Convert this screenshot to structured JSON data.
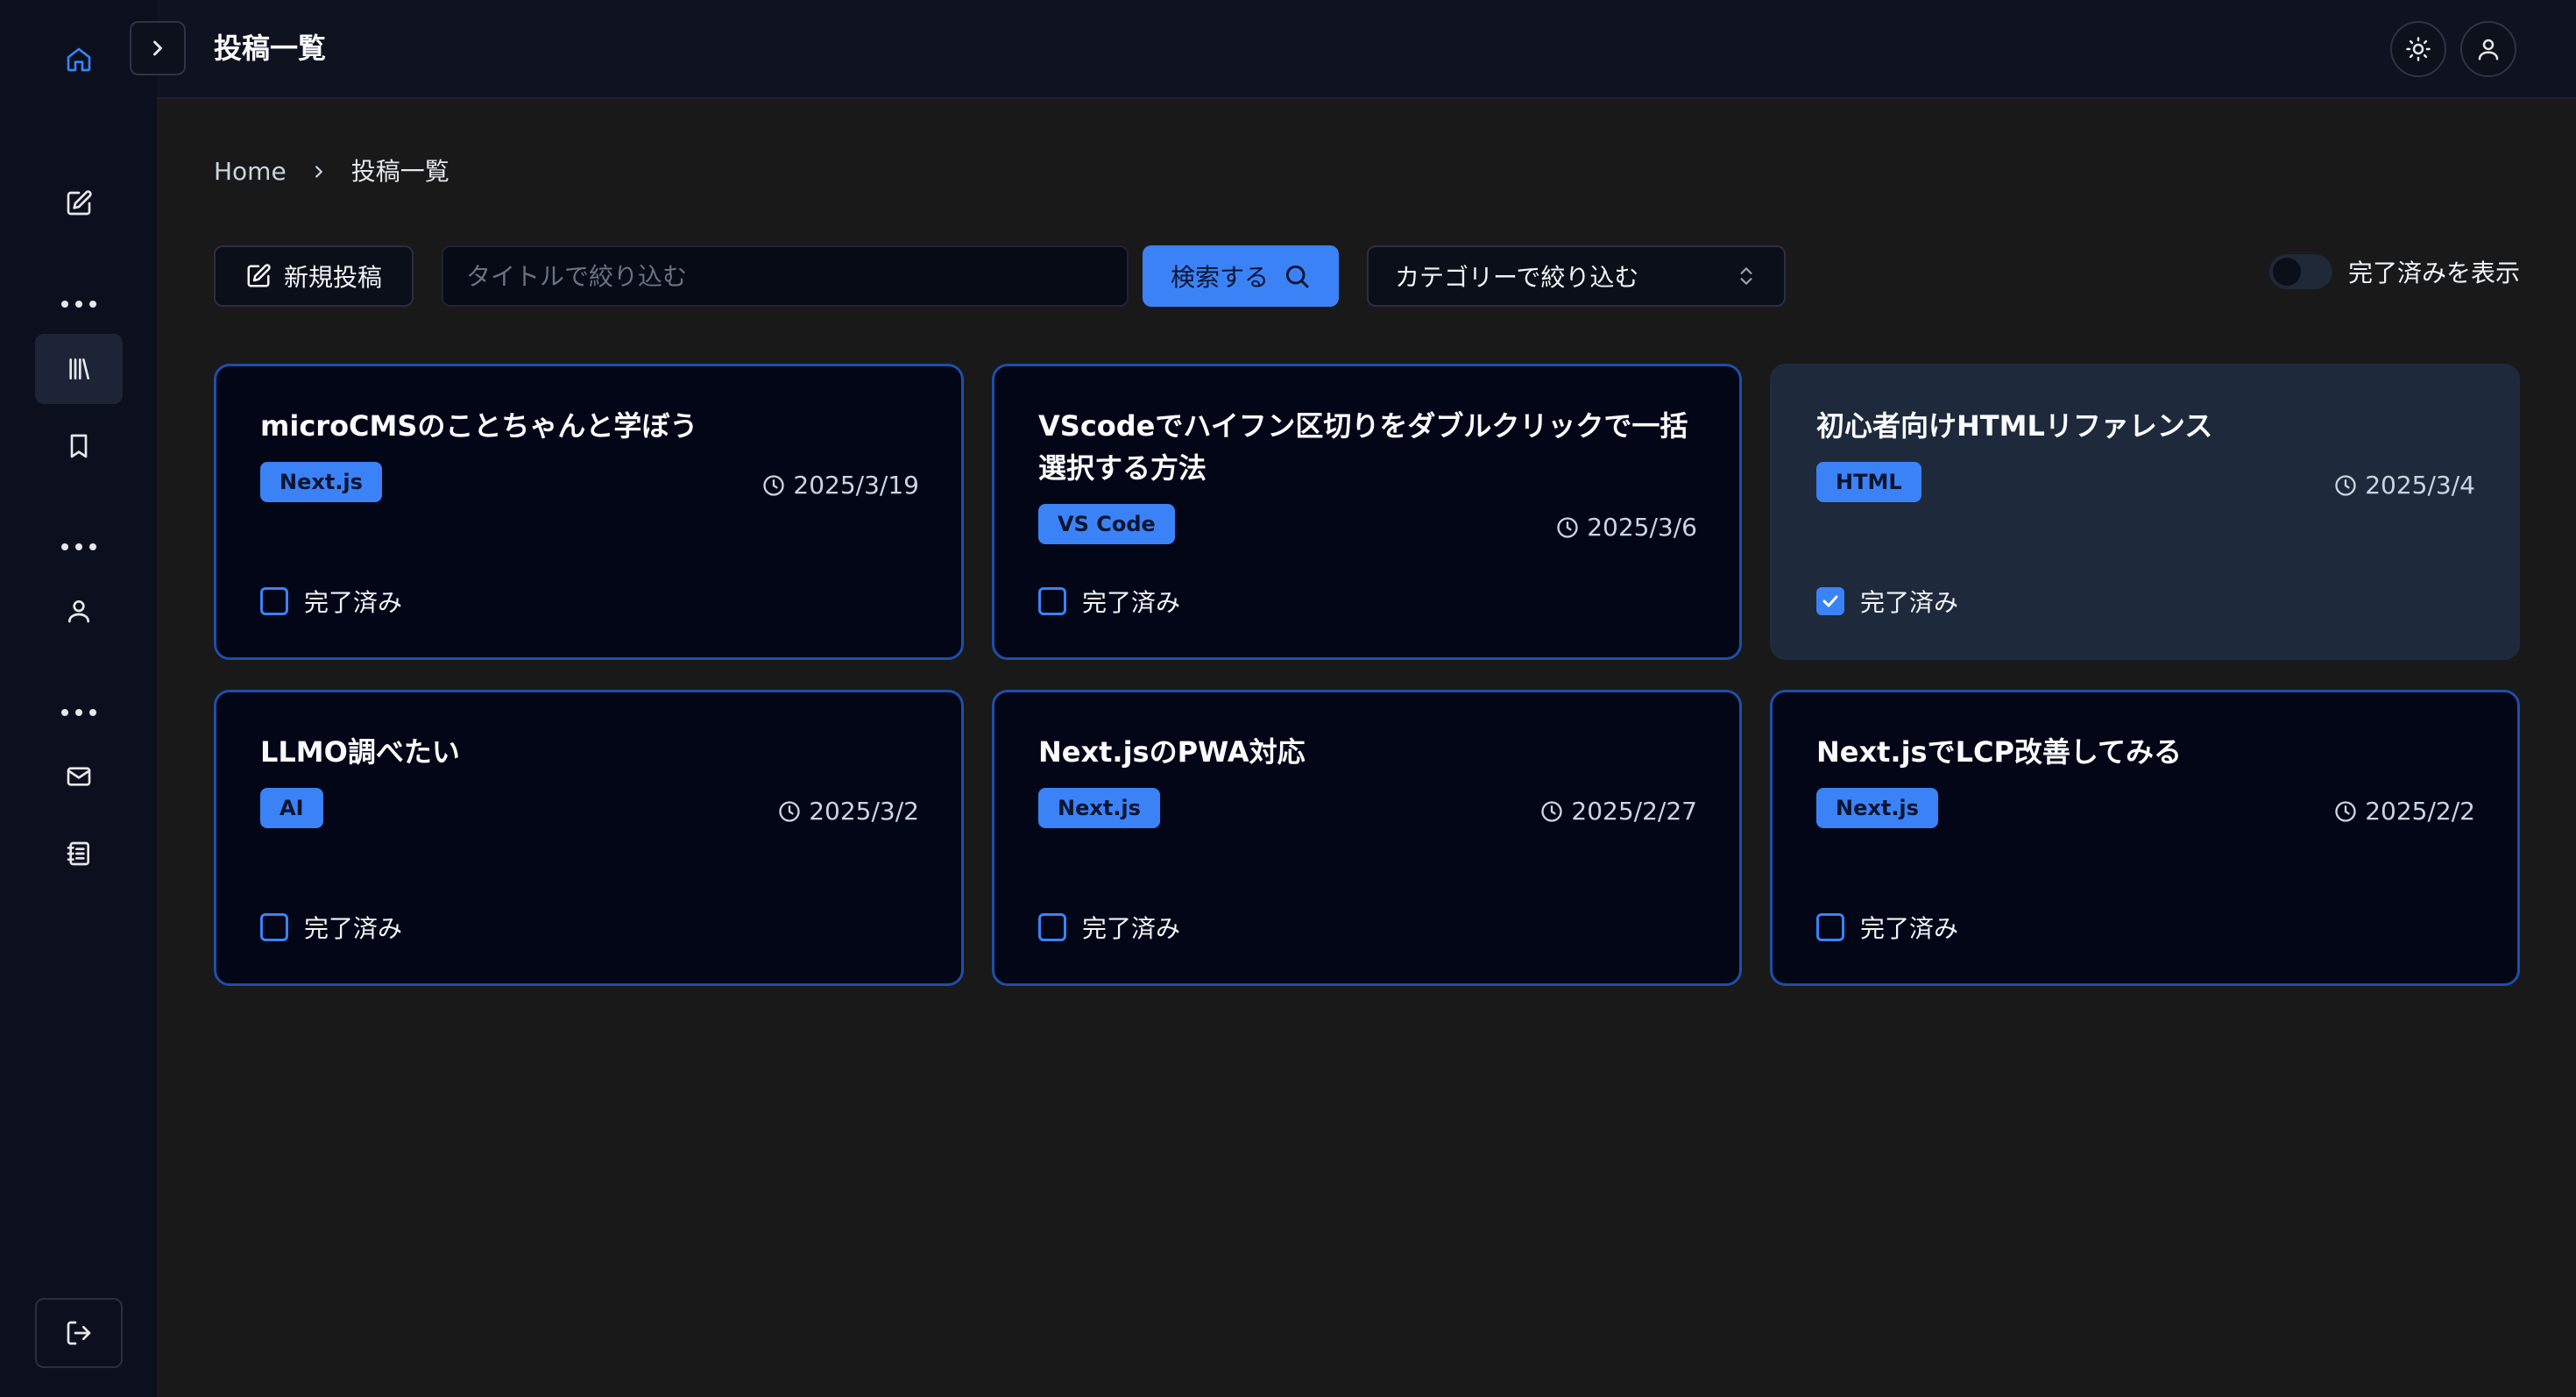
{
  "header": {
    "title": "投稿一覧"
  },
  "breadcrumb": {
    "home": "Home",
    "current": "投稿一覧"
  },
  "toolbar": {
    "new_post_label": "新規投稿",
    "search_placeholder": "タイトルで絞り込む",
    "search_button_label": "検索する",
    "category_select_value": "カテゴリーで絞り込む",
    "show_completed_label": "完了済みを表示",
    "show_completed_on": false
  },
  "checkbox_label": "完了済み",
  "posts": [
    {
      "title": "microCMSのことちゃんと学ぼう",
      "tag": "Next.js",
      "date": "2025/3/19",
      "completed": false
    },
    {
      "title": "VScodeでハイフン区切りをダブルクリックで一括選択する方法",
      "tag": "VS Code",
      "date": "2025/3/6",
      "completed": false
    },
    {
      "title": "初心者向けHTMLリファレンス",
      "tag": "HTML",
      "date": "2025/3/4",
      "completed": true
    },
    {
      "title": "LLMO調べたい",
      "tag": "AI",
      "date": "2025/3/2",
      "completed": false
    },
    {
      "title": "Next.jsのPWA対応",
      "tag": "Next.js",
      "date": "2025/2/27",
      "completed": false
    },
    {
      "title": "Next.jsでLCP改善してみる",
      "tag": "Next.js",
      "date": "2025/2/2",
      "completed": false
    }
  ],
  "sidebar": {
    "items": [
      {
        "icon": "home-icon",
        "active": false
      },
      {
        "icon": "edit-icon",
        "active": false
      },
      {
        "icon": "library-icon",
        "active": true
      },
      {
        "icon": "bookmark-icon",
        "active": false
      },
      {
        "icon": "user-icon",
        "active": false
      },
      {
        "icon": "mail-icon",
        "active": false
      },
      {
        "icon": "notebook-icon",
        "active": false
      },
      {
        "icon": "logout-icon",
        "active": false
      }
    ]
  },
  "colors": {
    "accent": "#3b82f6",
    "sidebar_bg": "#0c101e",
    "card_bg": "#020617",
    "card_border": "#1e4fa8",
    "card_done_bg": "#1e293b"
  }
}
